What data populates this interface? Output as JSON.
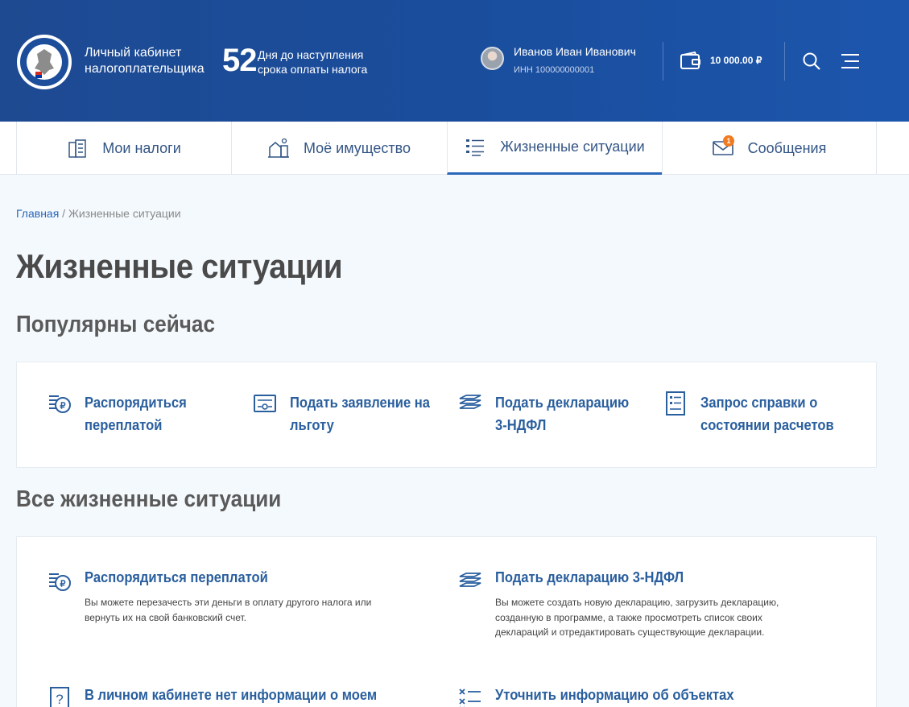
{
  "header": {
    "brand_line1": "Личный кабинет",
    "brand_line2": "налогоплательщика",
    "days_count": "52",
    "days_line1": "Дня до наступления",
    "days_line2": "срока оплаты налога",
    "user_name": "Иванов Иван Иванович",
    "user_inn": "ИНН 100000000001",
    "balance": "10 000.00 ₽"
  },
  "tabs": [
    {
      "label": "Мои налоги",
      "icon": "taxes-icon"
    },
    {
      "label": "Моё имущество",
      "icon": "property-icon"
    },
    {
      "label": "Жизненные ситуации",
      "icon": "list-icon",
      "active": true
    },
    {
      "label": "Сообщения",
      "icon": "mail-icon",
      "badge": "1"
    }
  ],
  "breadcrumb": {
    "home": "Главная",
    "separator": " / ",
    "current": "Жизненные ситуации"
  },
  "page_title": "Жизненные ситуации",
  "popular": {
    "title": "Популярны сейчас",
    "items": [
      {
        "label": "Распорядиться переплатой",
        "icon": "ruble-coins-icon"
      },
      {
        "label": "Подать заявление на льготу",
        "icon": "benefit-card-icon"
      },
      {
        "label": "Подать декларацию 3-НДФЛ",
        "icon": "declaration-icon"
      },
      {
        "label": "Запрос справки о состоянии расчетов",
        "icon": "document-list-icon"
      }
    ]
  },
  "all": {
    "title": "Все жизненные ситуации",
    "items": [
      {
        "title": "Распорядиться переплатой",
        "icon": "ruble-coins-icon",
        "desc": "Вы можете перезачесть эти деньги в оплату другого налога или вернуть их на свой банковский счет."
      },
      {
        "title": "Подать декларацию 3-НДФЛ",
        "icon": "declaration-icon",
        "desc": "Вы можете создать новую декларацию, загрузить декларацию, созданную в программе, а также просмотреть список своих деклараций и отредактировать существующие декларации."
      },
      {
        "title": "В личном кабинете нет информации о моем",
        "icon": "question-icon",
        "desc": ""
      },
      {
        "title": "Уточнить информацию об объектах",
        "icon": "checklist-icon",
        "desc": ""
      }
    ]
  },
  "colors": {
    "header": "#1d4f9f",
    "accent": "#2a67b9",
    "link": "#2a5f9e",
    "badge": "#f07a1f"
  }
}
